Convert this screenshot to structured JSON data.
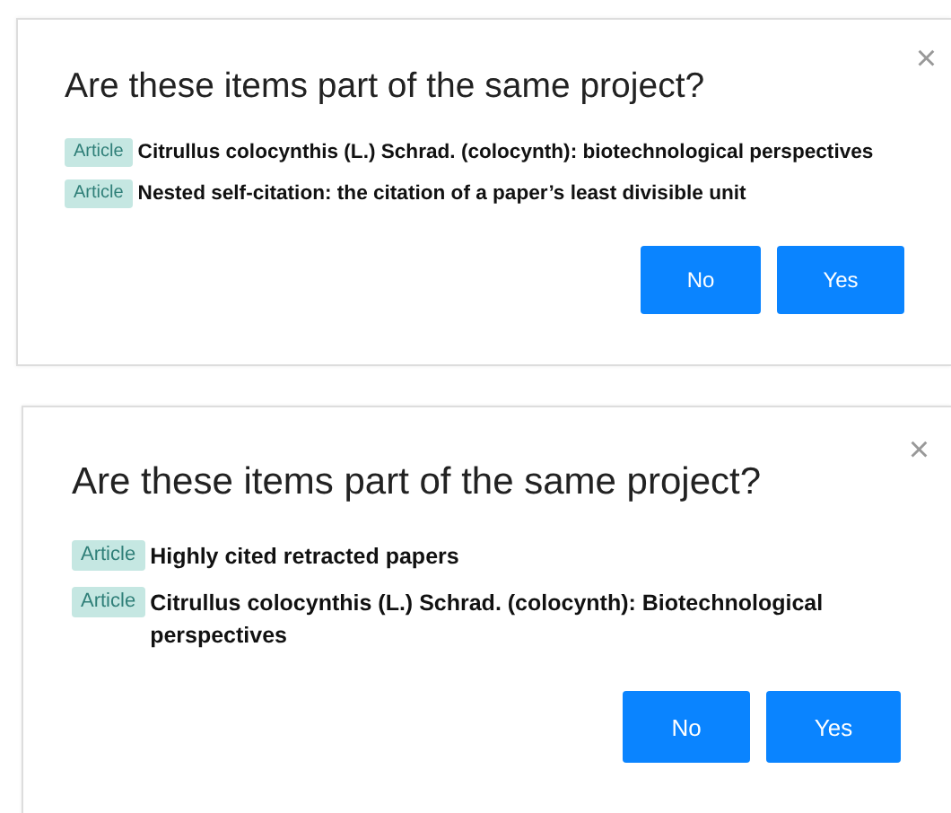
{
  "dialogs": [
    {
      "title": "Are these items part of the same project?",
      "close": "×",
      "items": [
        {
          "tag": "Article",
          "title": "Citrullus colocynthis (L.) Schrad. (colocynth): biotechnological perspectives"
        },
        {
          "tag": "Article",
          "title": "Nested self-citation: the citation of a paper’s least divisible unit"
        }
      ],
      "buttons": [
        "No",
        "Yes"
      ]
    },
    {
      "title": "Are these items part of the same project?",
      "close": "×",
      "items": [
        {
          "tag": "Article",
          "title": "Highly cited retracted papers"
        },
        {
          "tag": "Article",
          "title": "Citrullus colocynthis (L.) Schrad. (colocynth): Biotechnological perspectives"
        }
      ],
      "buttons": [
        "No",
        "Yes"
      ]
    }
  ]
}
